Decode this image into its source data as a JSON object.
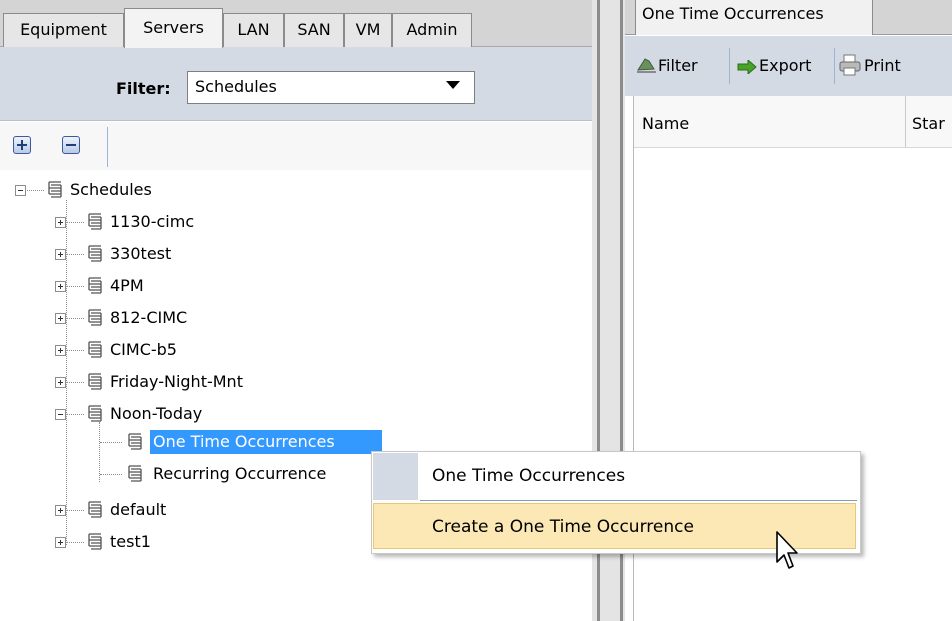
{
  "nav_tabs": [
    "Equipment",
    "Servers",
    "LAN",
    "SAN",
    "VM",
    "Admin"
  ],
  "filter": {
    "label": "Filter:",
    "value": "Schedules"
  },
  "tree": {
    "root": "Schedules",
    "items": [
      "1130-cimc",
      "330test",
      "4PM",
      "812-CIMC",
      "CIMC-b5",
      "Friday-Night-Mnt",
      "Noon-Today",
      "default",
      "test1"
    ],
    "noon_children": [
      "One Time Occurrences",
      "Recurring Occurrence"
    ]
  },
  "right": {
    "tab": "One Time Occurrences",
    "toolbar": {
      "filter": "Filter",
      "export": "Export",
      "print": "Print"
    },
    "columns": [
      "Name",
      "Star"
    ]
  },
  "context_menu": {
    "header": "One Time Occurrences",
    "items": [
      "Create a One Time Occurrence"
    ]
  },
  "colors": {
    "selection": "#3399ff",
    "menu_highlight": "#fbe8b4",
    "panel_bg": "#d3dae4"
  },
  "icons": [
    "schedule-icon",
    "expand-icon",
    "collapse-icon",
    "filter-icon",
    "export-arrow-icon",
    "printer-icon",
    "cursor-arrow-icon"
  ]
}
